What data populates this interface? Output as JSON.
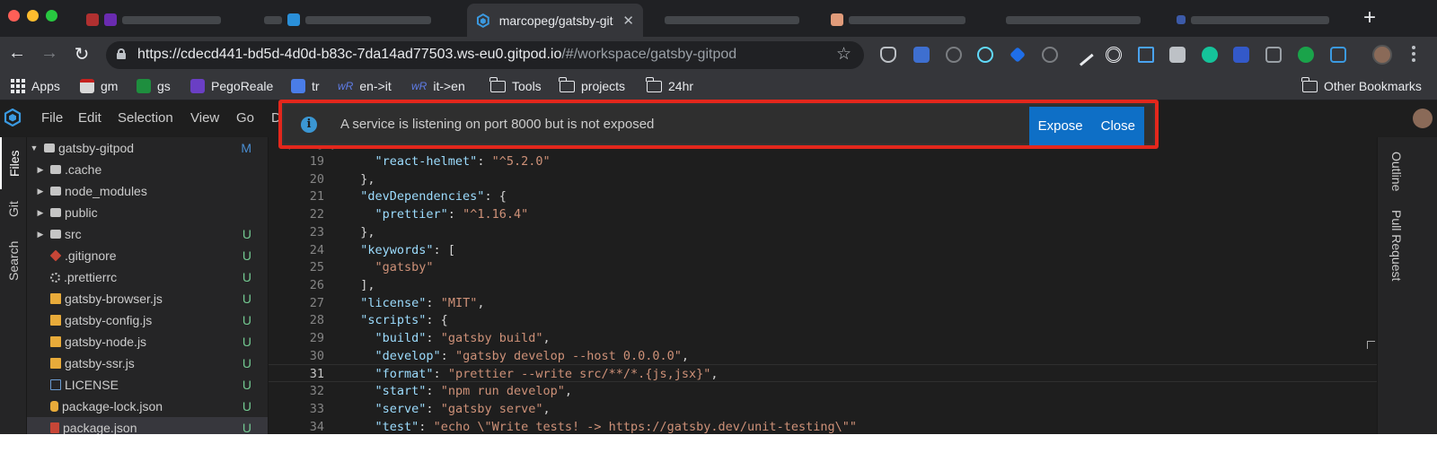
{
  "browser": {
    "active_tab_title": "marcopeg/gatsby-gitpod",
    "url_main": "https://cdecd441-bd5d-4d0d-b83c-7da14ad77503.ws-eu0.gitpod.io",
    "url_path": "/#/workspace/gatsby-gitpod",
    "bookmarks": [
      "Apps",
      "gm",
      "gs",
      "PegoReale",
      "tr",
      "en->it",
      "it->en",
      "Tools",
      "projects",
      "24hr"
    ],
    "other_bookmarks": "Other Bookmarks"
  },
  "ide": {
    "menu": [
      "File",
      "Edit",
      "Selection",
      "View",
      "Go",
      "De"
    ],
    "left_tabs": [
      "Files",
      "Git",
      "Search"
    ],
    "right_tabs": [
      "Outline",
      "Pull Request"
    ],
    "root": {
      "name": "gatsby-gitpod",
      "badge": "M"
    },
    "tree": [
      {
        "name": ".cache",
        "badge": ""
      },
      {
        "name": "node_modules",
        "badge": ""
      },
      {
        "name": "public",
        "badge": ""
      },
      {
        "name": "src",
        "badge": "U"
      },
      {
        "name": ".gitignore",
        "badge": "U"
      },
      {
        "name": ".prettierrc",
        "badge": "U"
      },
      {
        "name": "gatsby-browser.js",
        "badge": "U"
      },
      {
        "name": "gatsby-config.js",
        "badge": "U"
      },
      {
        "name": "gatsby-node.js",
        "badge": "U"
      },
      {
        "name": "gatsby-ssr.js",
        "badge": "U"
      },
      {
        "name": "LICENSE",
        "badge": "U"
      },
      {
        "name": "package-lock.json",
        "badge": "U"
      },
      {
        "name": "package.json",
        "badge": "U"
      }
    ],
    "crumb": "package.json",
    "code": [
      {
        "n": "19",
        "t": "    \"react-helmet\": \"^5.2.0\""
      },
      {
        "n": "20",
        "t": "  },"
      },
      {
        "n": "21",
        "t": "  \"devDependencies\": {"
      },
      {
        "n": "22",
        "t": "    \"prettier\": \"^1.16.4\""
      },
      {
        "n": "23",
        "t": "  },"
      },
      {
        "n": "24",
        "t": "  \"keywords\": ["
      },
      {
        "n": "25",
        "t": "    \"gatsby\""
      },
      {
        "n": "26",
        "t": "  ],"
      },
      {
        "n": "27",
        "t": "  \"license\": \"MIT\","
      },
      {
        "n": "28",
        "t": "  \"scripts\": {"
      },
      {
        "n": "29",
        "t": "    \"build\": \"gatsby build\","
      },
      {
        "n": "30",
        "t": "    \"develop\": \"gatsby develop --host 0.0.0.0\","
      },
      {
        "n": "31",
        "t": "    \"format\": \"prettier --write src/**/*.{js,jsx}\","
      },
      {
        "n": "32",
        "t": "    \"start\": \"npm run develop\","
      },
      {
        "n": "33",
        "t": "    \"serve\": \"gatsby serve\","
      },
      {
        "n": "34",
        "t": "    \"test\": \"echo \\\"Write tests! -> https://gatsby.dev/unit-testing\\\"\""
      }
    ],
    "current_line": "31"
  },
  "notification": {
    "message": "A service is listening on port 8000 but is not exposed",
    "expose_label": "Expose",
    "close_label": "Close"
  },
  "colors": {
    "badge_modified": "#4a8ed3",
    "badge_untracked": "#73c991",
    "highlight_border": "#e3271c",
    "button_blue": "#0e6fc6"
  }
}
